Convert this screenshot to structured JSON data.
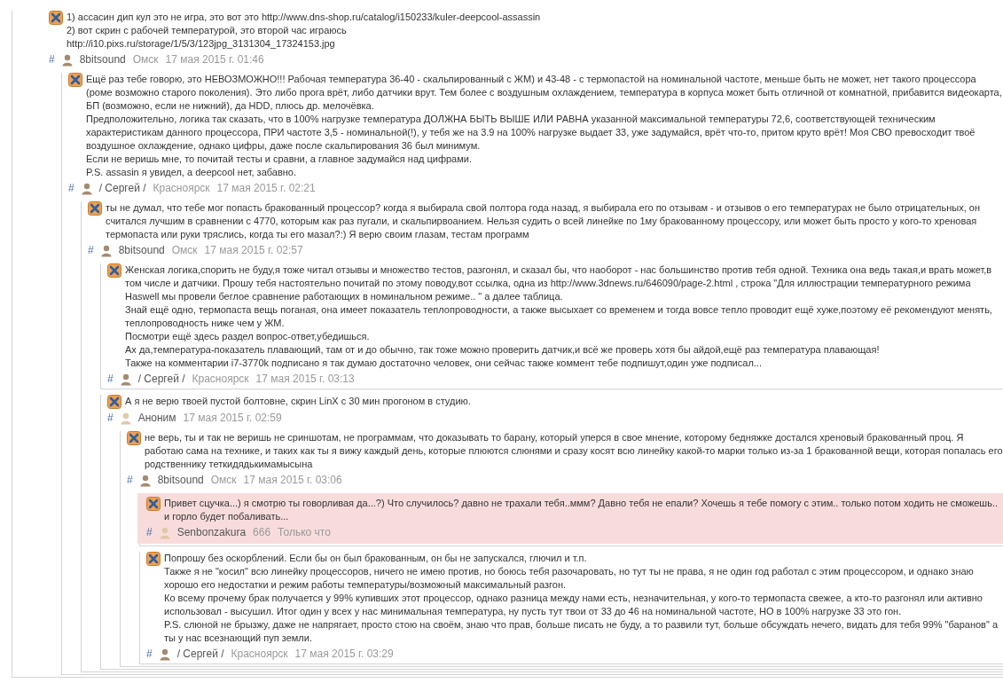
{
  "comments": [
    {
      "paragraphs": [
        "1) ассасин дип кул это не игра, это вот это http://www.dns-shop.ru/catalog/i150233/kuler-deepcool-assassin",
        "2) вот скрин с рабочей температурой, это второй час играюсь",
        "http://i10.pixs.ru/storage/1/5/3/123jpg_3131304_17324153.jpg"
      ],
      "meta": {
        "hash": "#",
        "registered": true,
        "author": "8bitsound",
        "location": "Омск",
        "date": "17 мая 2015 г. 01:46"
      },
      "children": [
        {
          "paragraphs": [
            "Ещё раз тебе говорю, это НЕВОЗМОЖНО!!! Рабочая температура 36-40 - скальпированный с ЖМ) и 43-48 - с термопастой на номинальной частоте, меньше быть не может, нет такого процессора (роме возможно старого поколения). Это либо прога врёт, либо датчики врут. Тем более с воздушным охлаждением, температура в корпуса может быть отличной от комнатной, прибавится видеокарта, БП (возможно, если не нижний), да HDD, плюсь др. мелочёвка.",
            "Предположительно, логика так сказать, что в 100% нагрузке температура ДОЛЖНА БЫТЬ ВЫШЕ ИЛИ РАВНА указанной максимальной температуры 72,6, соответствующей техническим характеристикам данного процессора, ПРИ частоте 3,5 - номинальной(!), у тебя же на 3.9 на 100% нагрузке выдает 33, уже задумайся, врёт что-то, притом круто врёт! Моя СВО превосходит твоё воздушное охлаждение, однако цифры, даже после скальпирования 36 был минимум.",
            "Если не веришь мне, то почитай тесты и сравни, а главное задумайся над цифрами.",
            "P.S. assasin я увидел, а deepcool нет, забавно."
          ],
          "meta": {
            "hash": "#",
            "registered": true,
            "author": "/ Сергей /",
            "location": "Красноярск",
            "date": "17 мая 2015 г. 02:21"
          },
          "children": [
            {
              "paragraphs": [
                "ты не думал, что тебе мог попасть бракованный процессор? когда я выбирала свой полтора года назад, я выбирала его по отзывам - и отзывов о его температурах не было отрицательных, он считался лучшим в сравнении с 4770, которым как раз пугали, и скальпирвоанием. Нельзя судить о всей линейке по 1му бракованному процессору, или может быть просто у кого-то хреновая термопаста или руки тряслись, когда ты его мазал?:) Я верю своим глазам, тестам программ"
              ],
              "meta": {
                "hash": "#",
                "registered": true,
                "author": "8bitsound",
                "location": "Омск",
                "date": "17 мая 2015 г. 02:57"
              },
              "children": [
                {
                  "paragraphs": [
                    "Женская логика,спорить не буду,я тоже читал отзывы и множество тестов, разгонял, и сказал бы, что наоборот - нас большинство против тебя одной. Техника она ведь такая,и врать может,в том числе и датчики. Прошу тебя настоятельно почитай по этому поводу,вот ссылка, одна из http://www.3dnews.ru/646090/page-2.html , строка \"Для иллюстрации температурного режима Haswell мы провели беглое сравнение работающих в номинальном режиме.. \" а далее таблица.",
                    "Знай ещё одно, термопаста вещь поганая, она имеет показатель теплопроводности, а также высыхает со временем и тогда вовсе тепло проводит ещё хуже,поэтому её рекомендуют менять, теплопроводность ниже чем у ЖМ.",
                    "Посмотри ещё здесь раздел вопрос-ответ,убедишься.",
                    "Ах да,температура-показатель плавающий, там от и до обычно, так тоже можно проверить датчик,и всё же проверь хотя бы айдой,ещё раз температура плавающая!",
                    "Также на комментарии i7-3770k подписано я так думаю достаточно человек, они сейчас также коммент тебе подпишут,один уже подписал..."
                  ],
                  "meta": {
                    "hash": "#",
                    "registered": true,
                    "author": "/ Сергей /",
                    "location": "Красноярск",
                    "date": "17 мая 2015 г. 03:13"
                  }
                },
                {
                  "paragraphs": [
                    "А я не верю твоей пустой болтовне, скрин LinX с 30 мин прогоном в студию."
                  ],
                  "meta": {
                    "hash": "#",
                    "registered": false,
                    "author": "Аноним",
                    "date": "17 мая 2015 г. 02:59"
                  },
                  "children": [
                    {
                      "paragraphs": [
                        "не верь, ты и так не веришь не сриншотам, не программам, что доказывать то барану, который уперся в свое мнение, которому бедняжке достался хреновый бракованный проц. Я работаю сама на технике, и таких как ты я вижу каждый день, которые плюются слюнями и сразу косят всю линейку какой-то марки только из-за 1 бракованной вещи, которая попалась его родственнику теткидядькимамысына"
                      ],
                      "meta": {
                        "hash": "#",
                        "registered": true,
                        "author": "8bitsound",
                        "location": "Омск",
                        "date": "17 мая 2015 г. 03:06"
                      },
                      "children": [
                        {
                          "highlighted": true,
                          "paragraphs": [
                            "Привет сцучка...) я смотрю ты говорливая да...?) Что случилось? давно не трахали тебя..ммм? Давно тебя не епали? Хочешь я тебе помогу с этим.. только потом ходить не сможешь.. и горло будет побаливать..."
                          ],
                          "meta": {
                            "hash": "#",
                            "registered": false,
                            "author": "Senbonzakura",
                            "location": "666",
                            "date": "Только что"
                          }
                        },
                        {
                          "paragraphs": [
                            "Попрошу без оскорблений. Если бы он был бракованным, он бы не запускался, глючил и т.п.",
                            "Также я не \"косил\" всю линейку процессоров, ничего не имею против, но боюсь тебя разочаровать, но тут ты не права, я не один год работал с этим процессором, и однако знаю хорошо его недостатки и режим работы температуры/возможный максимальный разгон.",
                            "Ко всему прочему брак получается у 99% купивших этот процессор, однако разница между нами есть, незначительная, у кого-то термопаста свежее, а кто-то разгонял или активно использовал - высушил. Итог один у всех у нас минимальная температура, ну пусть тут твои от 33 до 46 на номинальной частоте, НО в 100% нагрузке 33 это гон.",
                            "P.S. слюной не брызжу, даже не напрягает, просто стою на своём, знаю что прав, больше писать не буду, а то развили тут, больше обсуждать нечего, видать для тебя 99% \"баранов\" а ты у нас всезнающий пуп земли."
                          ],
                          "meta": {
                            "hash": "#",
                            "registered": true,
                            "author": "/ Сергей /",
                            "location": "Красноярск",
                            "date": "17 мая 2015 г. 03:29"
                          }
                        }
                      ]
                    }
                  ]
                }
              ]
            }
          ]
        }
      ]
    }
  ]
}
